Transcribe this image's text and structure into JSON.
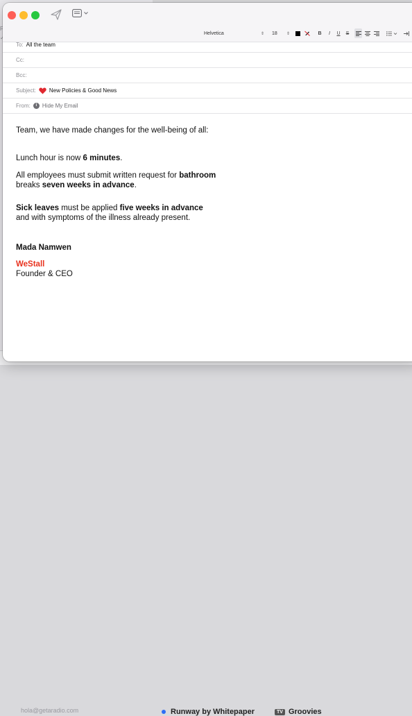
{
  "background": {
    "sidebar_marks": [
      "Fe",
      "✓"
    ],
    "footer_email": "hola@getaradio.com",
    "footer_item_1": "Runway by Whitepaper",
    "footer_item_2_tag": "TV",
    "footer_item_2": "Groovies"
  },
  "toolbar": {
    "send_icon": "paper-plane-icon",
    "header_fields_icon": "header-fields-icon"
  },
  "format": {
    "font": "Helvetica",
    "size": "18",
    "text_color": "#000000",
    "bold": "B",
    "italic": "I",
    "underline": "U",
    "strike": "S"
  },
  "fields": {
    "to_label": "To:",
    "to_value": "All the team",
    "cc_label": "Cc:",
    "bcc_label": "Bcc:",
    "subject_label": "Subject:",
    "subject_value": "New Policies & Good News",
    "from_label": "From:",
    "from_value": "Hide My Email"
  },
  "message": {
    "intro": "Team, we have made changes for the well-being of all:",
    "lunch_a": "Lunch hour is now ",
    "lunch_b": "6 minutes",
    "lunch_c": ".",
    "bath_a": "All employees must submit written request for ",
    "bath_b": "bathroom",
    "bath_c": "breaks ",
    "bath_d": "seven weeks in advance",
    "bath_e": ".",
    "sick_a": "Sick leaves",
    "sick_b": " must be applied ",
    "sick_c": "five weeks in advance",
    "sick_d": "and with symptoms of the illness already present.",
    "sign_name": "Mada Namwen",
    "sign_company": "WeStall",
    "sign_title": "Founder & CEO"
  },
  "colors": {
    "company": "#e8321e",
    "heart": "#e0282f"
  }
}
